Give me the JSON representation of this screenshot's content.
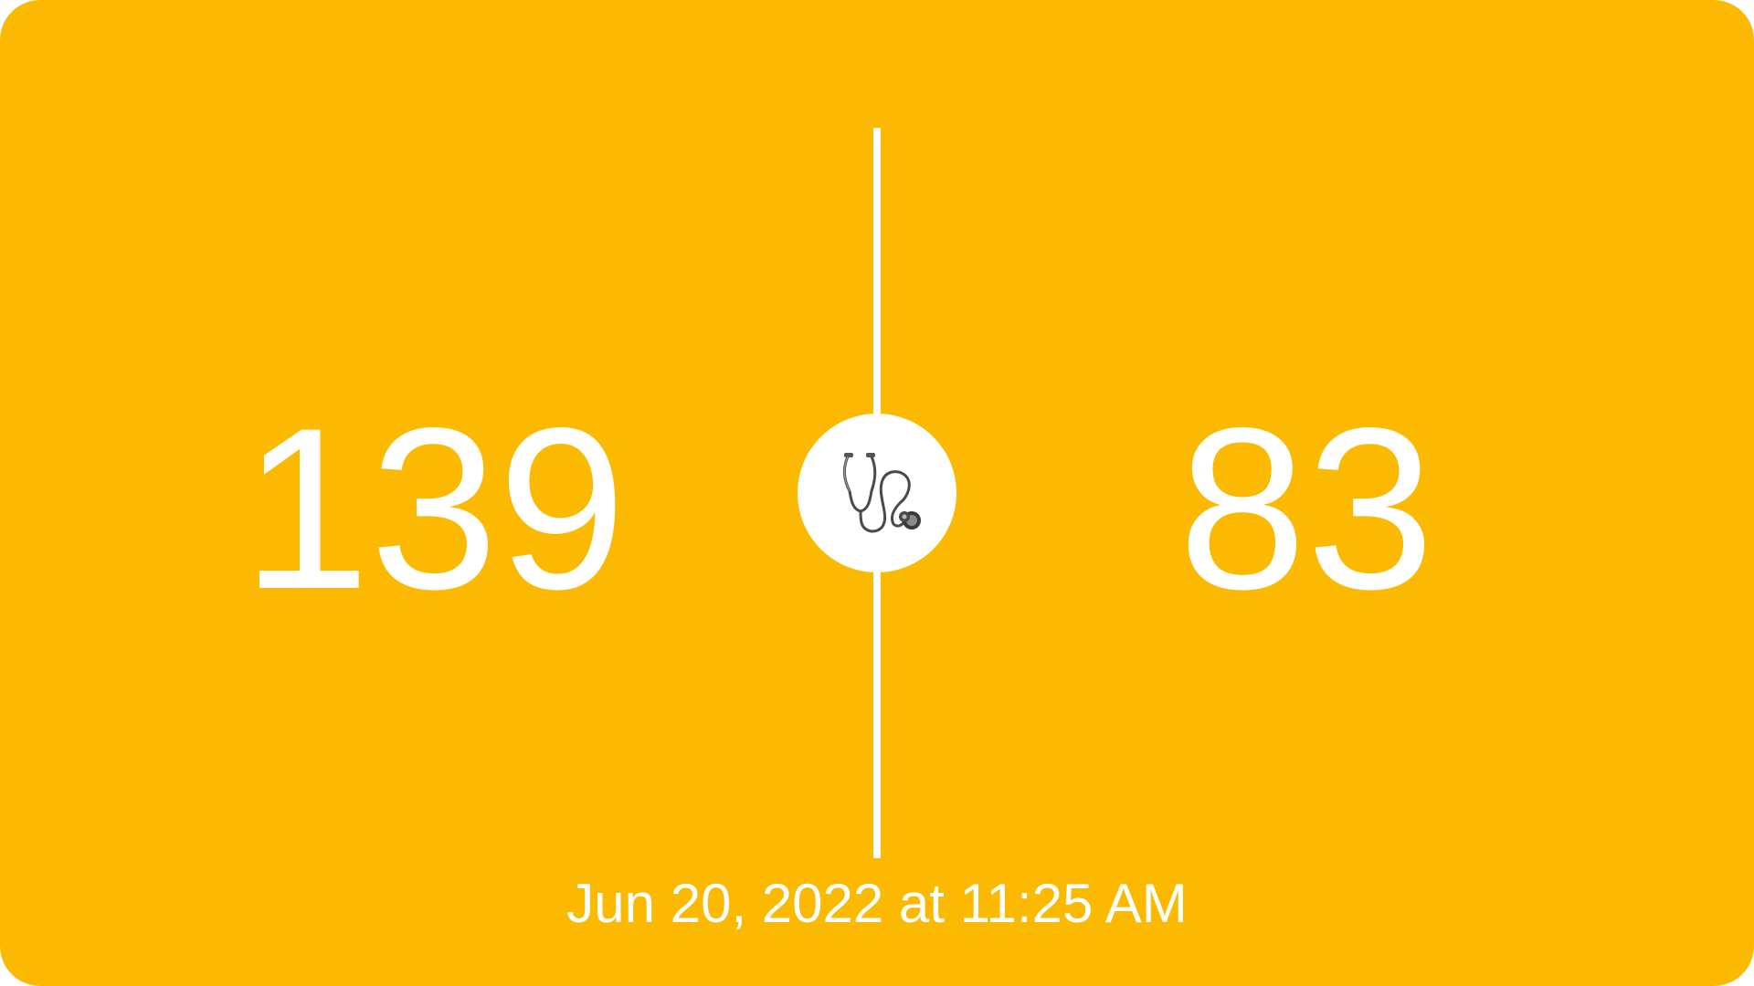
{
  "reading": {
    "systolic": "139",
    "diastolic": "83",
    "timestamp": "Jun 20, 2022 at 11:25 AM"
  },
  "icon": {
    "name": "stethoscope-icon"
  },
  "colors": {
    "background": "#FCB902",
    "foreground": "#FFFFFF"
  }
}
